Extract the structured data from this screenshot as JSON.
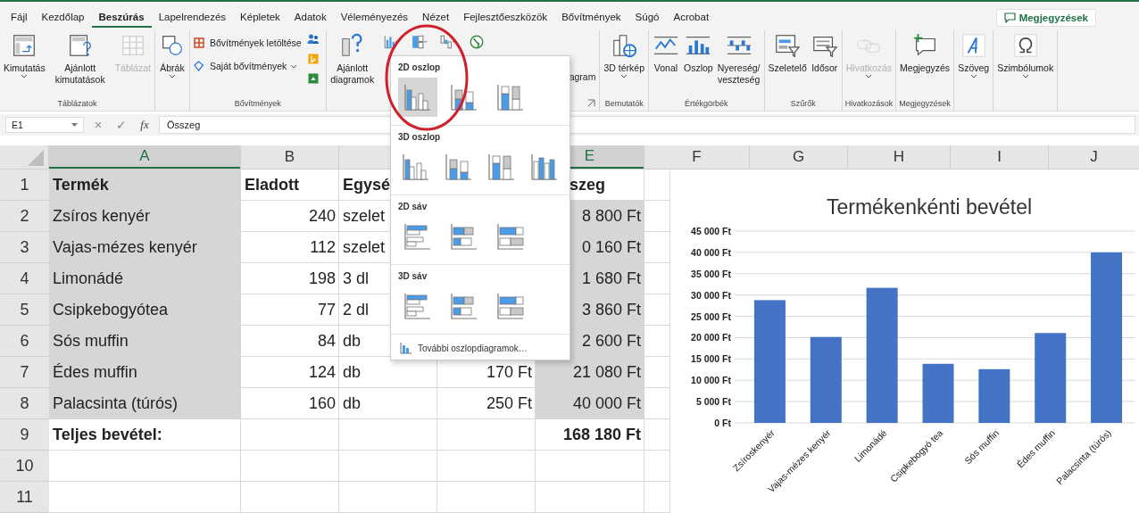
{
  "tabs": [
    {
      "label": "Fájl",
      "selected": false
    },
    {
      "label": "Kezdőlap",
      "selected": false
    },
    {
      "label": "Beszúrás",
      "selected": true
    },
    {
      "label": "Lapelrendezés",
      "selected": false
    },
    {
      "label": "Képletek",
      "selected": false
    },
    {
      "label": "Adatok",
      "selected": false
    },
    {
      "label": "Véleményezés",
      "selected": false
    },
    {
      "label": "Nézet",
      "selected": false
    },
    {
      "label": "Fejlesztőeszközök",
      "selected": false
    },
    {
      "label": "Bővítmények",
      "selected": false
    },
    {
      "label": "Súgó",
      "selected": false
    },
    {
      "label": "Acrobat",
      "selected": false
    }
  ],
  "comments_button": {
    "label": "Megjegyzések"
  },
  "ribbon": [
    {
      "kind": "large",
      "label": "Táblázatok",
      "commands": [
        {
          "label": "Kimutatás",
          "dropdown": true,
          "disabled": false
        },
        {
          "label": "Ajánlott kimutatások",
          "dropdown": false,
          "disabled": false
        },
        {
          "label": "Táblázat",
          "dropdown": false,
          "disabled": true
        }
      ]
    },
    {
      "kind": "large",
      "commands": [
        {
          "label": "Ábrák",
          "dropdown": true,
          "disabled": false
        }
      ]
    },
    {
      "kind": "addins",
      "label": "Bővítmények",
      "commands": [
        {
          "label": "Bővítmények letöltése",
          "dropdown": false
        },
        {
          "label": "Saját bővítmények",
          "dropdown": true
        }
      ]
    },
    {
      "kind": "charts",
      "commands": [
        {
          "label": "Ajánlott diagramok"
        }
      ],
      "covered_label": "agram"
    },
    {
      "kind": "large",
      "label": "Bemutatók",
      "commands": [
        {
          "label": "3D térkép",
          "dropdown": true,
          "disabled": false
        }
      ]
    },
    {
      "kind": "large",
      "label": "Értékgörbék",
      "commands": [
        {
          "label": "Vonal",
          "dropdown": false,
          "disabled": false
        },
        {
          "label": "Oszlop",
          "dropdown": false,
          "disabled": false
        },
        {
          "label": "Nyereség/\nveszteség",
          "dropdown": false,
          "disabled": false
        }
      ]
    },
    {
      "kind": "large",
      "label": "Szűrők",
      "commands": [
        {
          "label": "Szeletelő",
          "dropdown": false,
          "disabled": false
        },
        {
          "label": "Idősor",
          "dropdown": false,
          "disabled": false
        }
      ]
    },
    {
      "kind": "large",
      "label": "Hivatkozások",
      "commands": [
        {
          "label": "Hivatkozás",
          "dropdown": true,
          "disabled": true
        }
      ]
    },
    {
      "kind": "large",
      "label": "Megjegyzések",
      "commands": [
        {
          "label": "Megjegyzés",
          "dropdown": false,
          "disabled": false
        }
      ]
    },
    {
      "kind": "large",
      "commands": [
        {
          "label": "Szöveg",
          "dropdown": true,
          "disabled": false
        }
      ]
    },
    {
      "kind": "large",
      "commands": [
        {
          "label": "Szimbólumok",
          "dropdown": true,
          "disabled": false
        }
      ]
    }
  ],
  "formula_bar": {
    "name_box": "E1",
    "cancel": "×",
    "enter": "✓",
    "function": "fx",
    "value": "Összeg"
  },
  "columns": [
    {
      "label": "A",
      "selected": true
    },
    {
      "label": "B",
      "selected": false
    },
    {
      "selected": false
    },
    {},
    {
      "label": "E",
      "selected": true
    },
    {
      "label": "F",
      "selected": false
    },
    {
      "label": "G",
      "selected": false
    },
    {
      "label": "H",
      "selected": false
    },
    {
      "label": "I",
      "selected": false
    },
    {
      "label": "J",
      "selected": false
    }
  ],
  "rows": [
    {
      "number": "1",
      "kind": "header",
      "cells": [
        {
          "text": "Termék",
          "selected": true
        },
        {
          "text": "Eladott",
          "selected": false
        },
        {
          "text": "Egysé",
          "selected": false
        },
        {},
        {
          "text": "szeg",
          "selected": false
        }
      ]
    },
    {
      "number": "2",
      "kind": "data",
      "cells": [
        {
          "text": "Zsíros kenyér",
          "selected": true
        },
        {
          "text": "240",
          "selected": false
        },
        {
          "text": "szelet",
          "selected": false
        },
        {},
        {
          "text": "8 800 Ft",
          "selected": true
        }
      ]
    },
    {
      "number": "3",
      "kind": "data",
      "cells": [
        {
          "text": "Vajas-mézes kenyér",
          "selected": true
        },
        {
          "text": "112",
          "selected": false
        },
        {
          "text": "szelet",
          "selected": false
        },
        {},
        {
          "text": "0 160 Ft",
          "selected": true
        }
      ]
    },
    {
      "number": "4",
      "kind": "data",
      "cells": [
        {
          "text": "Limonádé",
          "selected": true
        },
        {
          "text": "198",
          "selected": false
        },
        {
          "text": "3 dl",
          "selected": false
        },
        {},
        {
          "text": "1 680 Ft",
          "selected": true
        }
      ]
    },
    {
      "number": "5",
      "kind": "data",
      "cells": [
        {
          "text": "Csipkebogyótea",
          "selected": true
        },
        {
          "text": "77",
          "selected": false
        },
        {
          "text": "2 dl",
          "selected": false
        },
        {},
        {
          "text": "3 860 Ft",
          "selected": true
        }
      ]
    },
    {
      "number": "6",
      "kind": "data",
      "cells": [
        {
          "text": "Sós muffin",
          "selected": true
        },
        {
          "text": "84",
          "selected": false
        },
        {
          "text": "db",
          "selected": false
        },
        {},
        {
          "text": "2 600 Ft",
          "selected": true
        }
      ]
    },
    {
      "number": "7",
      "kind": "data",
      "cells": [
        {
          "text": "Édes muffin",
          "selected": true
        },
        {
          "text": "124",
          "selected": false
        },
        {
          "text": "db",
          "selected": false
        },
        {
          "text": "170 Ft",
          "selected": false
        },
        {
          "text": "21 080 Ft",
          "selected": true
        }
      ]
    },
    {
      "number": "8",
      "kind": "data",
      "cells": [
        {
          "text": "Palacsinta (túrós)",
          "selected": true
        },
        {
          "text": "160",
          "selected": false
        },
        {
          "text": "db",
          "selected": false
        },
        {
          "text": "250 Ft",
          "selected": false
        },
        {
          "text": "40 000 Ft",
          "selected": true
        }
      ]
    },
    {
      "number": "9",
      "kind": "total",
      "cells": [
        {
          "text": "Teljes bevétel:",
          "selected": false
        },
        {},
        {},
        {},
        {
          "text": "168 180 Ft",
          "selected": false
        }
      ]
    },
    {
      "number": "10"
    },
    {
      "number": "11"
    }
  ],
  "chart": {
    "chart_data": {
      "type": "bar",
      "title": "Termékenkénti bevétel",
      "grid": true,
      "ylim": [
        0,
        45000
      ],
      "categories": [
        "Zsíroskenyér",
        "Vajas-mézes kenyér",
        "Limonádé",
        "Csipkebogyó tea",
        "Sós muffin",
        "Édes muffin",
        "Palacsinta (túrós)"
      ],
      "series": [
        {
          "color": "#4472c4",
          "values": [
            28800,
            20160,
            31680,
            13860,
            12600,
            21080,
            40000
          ]
        }
      ],
      "yticks": [
        {
          "value": 0,
          "label": "0 Ft"
        },
        {
          "value": 5000,
          "label": "5 000 Ft"
        },
        {
          "value": 10000,
          "label": "10 000 Ft"
        },
        {
          "value": 15000,
          "label": "15 000 Ft"
        },
        {
          "value": 20000,
          "label": "20 000 Ft"
        },
        {
          "value": 25000,
          "label": "25 000 Ft"
        },
        {
          "value": 30000,
          "label": "30 000 Ft"
        },
        {
          "value": 35000,
          "label": "35 000 Ft"
        },
        {
          "value": 40000,
          "label": "40 000 Ft"
        },
        {
          "value": 45000,
          "label": "45 000 Ft"
        }
      ]
    }
  },
  "chart_menu": {
    "sections": [
      {
        "title": "2D oszlop",
        "kind": "column",
        "items": [
          {
            "kind": "clustered",
            "selected": true
          },
          {
            "kind": "stacked",
            "selected": false
          },
          {
            "kind": "percent",
            "selected": false
          }
        ]
      },
      {
        "title": "3D oszlop",
        "kind": "column",
        "items": [
          {
            "kind": "clustered",
            "selected": false
          },
          {
            "kind": "stacked",
            "selected": false
          },
          {
            "kind": "percent",
            "selected": false
          },
          {
            "kind": "threed",
            "selected": false
          }
        ]
      },
      {
        "title": "2D sáv",
        "kind": "bar",
        "items": [
          {
            "kind": "clustered",
            "selected": false
          },
          {
            "kind": "stacked",
            "selected": false
          },
          {
            "kind": "percent",
            "selected": false
          }
        ]
      },
      {
        "title": "3D sáv",
        "kind": "bar",
        "items": [
          {
            "kind": "clustered",
            "selected": false
          },
          {
            "kind": "stacked",
            "selected": false
          },
          {
            "kind": "percent",
            "selected": false
          }
        ]
      }
    ],
    "footer": "További oszlopdiagramok…"
  }
}
